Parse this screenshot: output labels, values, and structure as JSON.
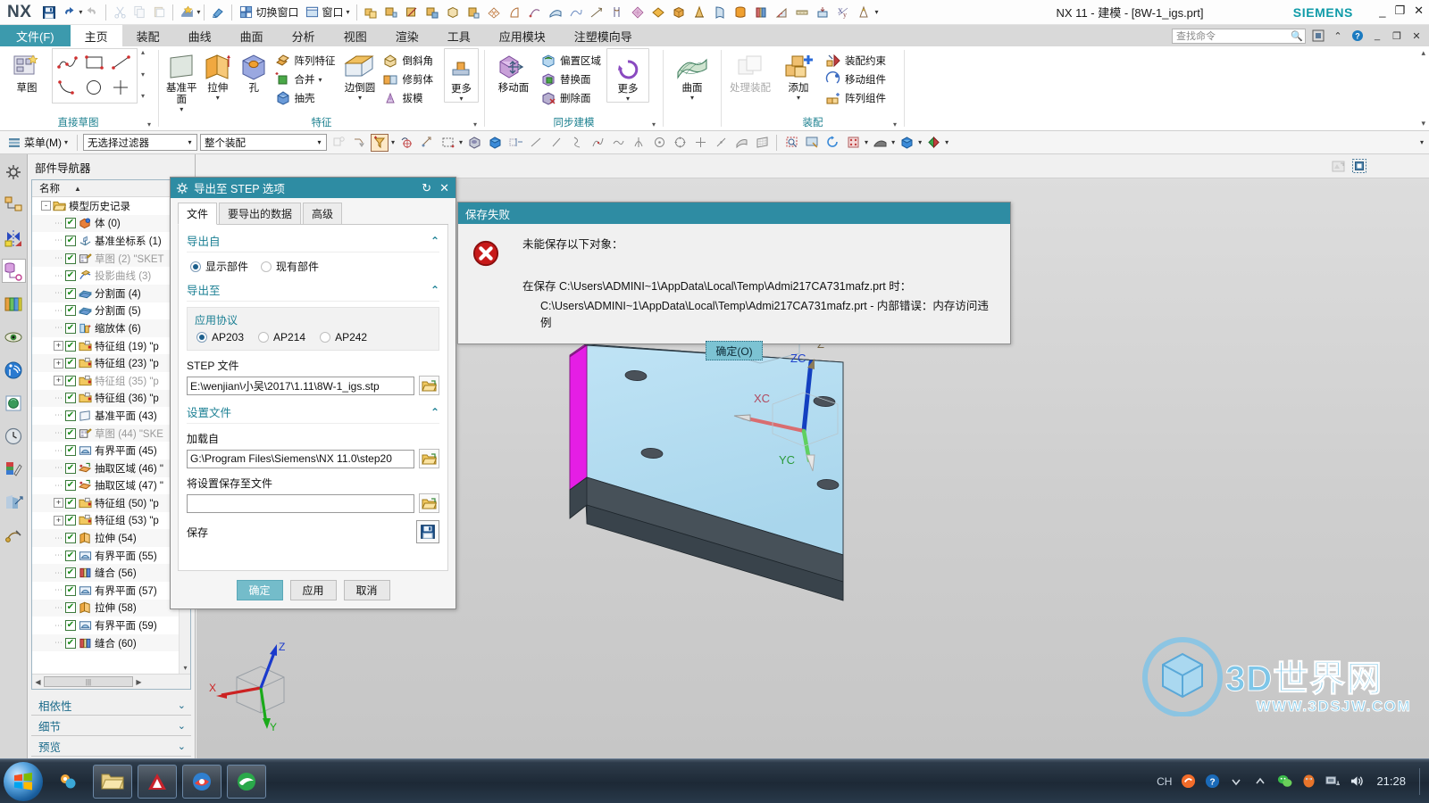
{
  "titlebar": {
    "logo": "NX",
    "window_title": "NX 11 - 建模 - [8W-1_igs.prt]",
    "brand": "SIEMENS",
    "switch_window_label": "切换窗口",
    "window_label": "窗口",
    "quick_access": [
      "save-icon",
      "undo-icon",
      "redo-icon",
      "cut-icon",
      "copy-icon",
      "paste-icon",
      "update-icon",
      "erase-icon"
    ],
    "win_minimize": "_",
    "win_restore": "❐",
    "win_close": "✕"
  },
  "tabs": {
    "file": "文件(F)",
    "items": [
      "主页",
      "装配",
      "曲线",
      "曲面",
      "分析",
      "视图",
      "渲染",
      "工具",
      "应用模块",
      "注塑模向导"
    ],
    "active": "主页"
  },
  "search": {
    "placeholder": "查找命令"
  },
  "ribbon": {
    "groups": [
      {
        "label": "直接草图",
        "big": [
          {
            "label": "草图",
            "icon": "sketch-icon"
          }
        ],
        "gallery": [
          "profile-icon",
          "rectangle-icon",
          "line-icon",
          "arc-icon",
          "circle-icon",
          "fillet-icon"
        ]
      },
      {
        "label": "特征",
        "big": [
          {
            "label": "基准平面",
            "icon": "datum-plane-icon"
          },
          {
            "label": "拉伸",
            "icon": "extrude-icon"
          },
          {
            "label": "孔",
            "icon": "hole-icon"
          }
        ],
        "small": [
          "阵列特征",
          "合并",
          "抽壳"
        ],
        "big2": [
          {
            "label": "边倒圆",
            "icon": "edge-blend-icon"
          }
        ],
        "small2": [
          "倒斜角",
          "修剪体",
          "拔模"
        ],
        "more": "更多"
      },
      {
        "label": "同步建模",
        "big": [
          {
            "label": "移动面",
            "icon": "move-face-icon"
          }
        ],
        "small": [
          "偏置区域",
          "替换面",
          "删除面"
        ],
        "more": "更多"
      },
      {
        "label": "",
        "big": [
          {
            "label": "曲面",
            "icon": "surface-icon"
          }
        ]
      },
      {
        "label": "装配",
        "big": [
          {
            "label": "处理装配",
            "icon": "process-assembly-icon",
            "disabled": true
          },
          {
            "label": "添加",
            "icon": "add-component-icon"
          }
        ],
        "small": [
          "装配约束",
          "移动组件",
          "阵列组件"
        ]
      }
    ]
  },
  "selection_bar": {
    "menu_label": "菜单(M)",
    "filter_value": "无选择过滤器",
    "scope_value": "整个装配"
  },
  "navigator": {
    "title": "部件导航器",
    "column_name": "名称",
    "root": "模型历史记录",
    "sections": [
      "相依性",
      "细节",
      "预览"
    ],
    "tree": [
      {
        "expand": "-",
        "name": "模型历史记录",
        "icon": "folder-icon",
        "root": true
      },
      {
        "expand": "",
        "name": "体 (0)",
        "icon": "body-icon"
      },
      {
        "expand": "",
        "name": "基准坐标系 (1)",
        "icon": "datum-csys-icon"
      },
      {
        "expand": "",
        "name": "草图 (2) \"SKET",
        "icon": "sketch-icon",
        "dim": true
      },
      {
        "expand": "",
        "name": "投影曲线 (3)",
        "icon": "project-curve-icon",
        "dim": true
      },
      {
        "expand": "",
        "name": "分割面 (4)",
        "icon": "divide-face-icon"
      },
      {
        "expand": "",
        "name": "分割面 (5)",
        "icon": "divide-face-icon"
      },
      {
        "expand": "",
        "name": "缩放体 (6)",
        "icon": "scale-body-icon"
      },
      {
        "expand": "+",
        "name": "特征组 (19) \"p",
        "icon": "feature-group-icon"
      },
      {
        "expand": "+",
        "name": "特征组 (23) \"p",
        "icon": "feature-group-icon"
      },
      {
        "expand": "+",
        "name": "特征组 (35) \"p",
        "icon": "feature-group-icon",
        "dim": true
      },
      {
        "expand": "",
        "name": "特征组 (36) \"p",
        "icon": "feature-group-icon"
      },
      {
        "expand": "",
        "name": "基准平面 (43)",
        "icon": "datum-plane-icon"
      },
      {
        "expand": "",
        "name": "草图 (44) \"SKE",
        "icon": "sketch-icon",
        "dim": true
      },
      {
        "expand": "",
        "name": "有界平面 (45)",
        "icon": "bounded-plane-icon"
      },
      {
        "expand": "",
        "name": "抽取区域 (46) \"",
        "icon": "extract-region-icon"
      },
      {
        "expand": "",
        "name": "抽取区域 (47) \"",
        "icon": "extract-region-icon"
      },
      {
        "expand": "+",
        "name": "特征组 (50) \"p",
        "icon": "feature-group-icon"
      },
      {
        "expand": "+",
        "name": "特征组 (53) \"p",
        "icon": "feature-group-icon"
      },
      {
        "expand": "",
        "name": "拉伸 (54)",
        "icon": "extrude-icon"
      },
      {
        "expand": "",
        "name": "有界平面 (55)",
        "icon": "bounded-plane-icon"
      },
      {
        "expand": "",
        "name": "缝合 (56)",
        "icon": "sew-icon"
      },
      {
        "expand": "",
        "name": "有界平面 (57)",
        "icon": "bounded-plane-icon"
      },
      {
        "expand": "",
        "name": "拉伸 (58)",
        "icon": "extrude-icon"
      },
      {
        "expand": "",
        "name": "有界平面 (59)",
        "icon": "bounded-plane-icon"
      },
      {
        "expand": "",
        "name": "缝合 (60)",
        "icon": "sew-icon"
      }
    ]
  },
  "export_dialog": {
    "title": "导出至 STEP 选项",
    "reset_icon": "reset-icon",
    "close_icon": "close-icon",
    "tabs": [
      "文件",
      "要导出的数据",
      "高级"
    ],
    "active_tab": "文件",
    "export_from": {
      "heading": "导出自",
      "options": [
        "显示部件",
        "现有部件"
      ],
      "selected": "显示部件"
    },
    "export_to": {
      "heading": "导出至",
      "protocol_label": "应用协议",
      "protocols": [
        "AP203",
        "AP214",
        "AP242"
      ],
      "selected_protocol": "AP203",
      "step_file_label": "STEP 文件",
      "step_file_value": "E:\\wenjian\\小吴\\2017\\1.11\\8W-1_igs.stp"
    },
    "settings_file": {
      "heading": "设置文件",
      "load_from_label": "加载自",
      "load_from_value": "G:\\Program Files\\Siemens\\NX 11.0\\step20",
      "save_to_label": "将设置保存至文件",
      "save_to_value": "",
      "save_label": "保存"
    },
    "buttons": {
      "ok": "确定",
      "apply": "应用",
      "cancel": "取消"
    }
  },
  "error_dialog": {
    "title": "保存失败",
    "icon": "error-icon",
    "line1": "未能保存以下对象：",
    "line2": "在保存 C:\\Users\\ADMINI~1\\AppData\\Local\\Temp\\Admi217CA731mafz.prt 时：",
    "line3": "C:\\Users\\ADMINI~1\\AppData\\Local\\Temp\\Admi217CA731mafz.prt -  内部错误：内存访问违例",
    "ok_label": "确定(O)"
  },
  "viewport": {
    "triad_axes": [
      "X",
      "Y",
      "Z"
    ],
    "wcs_axes": [
      "XC",
      "YC",
      "ZC"
    ],
    "z_axis_label": "Z"
  },
  "watermark": {
    "text": "3D世界网",
    "url": "WWW.3DSJW.COM"
  },
  "taskbar": {
    "clock": "21:28",
    "ime": "CH",
    "buttons": [
      "explorer-icon",
      "autocad-icon",
      "browser-icon",
      "ie-icon"
    ],
    "tray": [
      "sogou-icon",
      "help-icon",
      "show-hidden-icon",
      "wechat-icon",
      "qq-icon",
      "network-icon",
      "volume-icon"
    ]
  }
}
